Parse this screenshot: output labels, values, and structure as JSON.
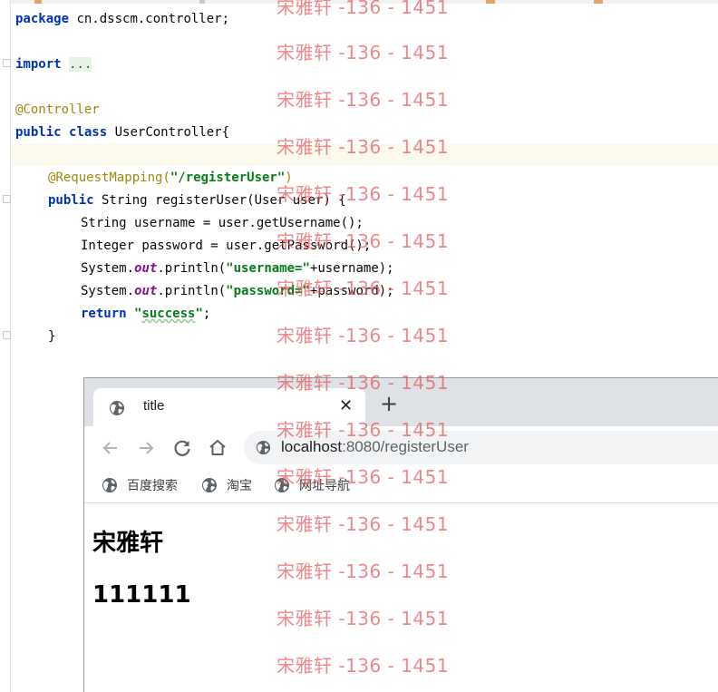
{
  "editor": {
    "line1": {
      "kw": "package",
      "rest": " cn.dsscm.controller;"
    },
    "line2": {
      "kw": "import",
      "folded": "..."
    },
    "line3": {
      "annotation": "@Controller"
    },
    "line4": {
      "kw1": "public",
      "kw2": "class",
      "rest": " UserController{"
    },
    "line5": {
      "annotation": "@RequestMapping(",
      "string": "\"/registerUser\"",
      "close": ")"
    },
    "line6": {
      "kw": "public",
      "rest": " String registerUser(User user) {"
    },
    "line7": {
      "text": "String username = user.getUsername();"
    },
    "line8": {
      "text": "Integer password = user.getPassword();"
    },
    "line9": {
      "prefix": "System.",
      "field": "out",
      "mid": ".println(",
      "string": "\"username=\"",
      "suffix": "+username);"
    },
    "line10": {
      "prefix": "System.",
      "field": "out",
      "mid": ".println(",
      "string": "\"password=\"",
      "suffix": "+password);"
    },
    "line11": {
      "kw": "return",
      "string_open": "\"",
      "string_word": "success",
      "string_close": "\"",
      "suffix": ";"
    },
    "line12": {
      "text": "}"
    }
  },
  "browser": {
    "tab_title": "title",
    "tab_close": "✕",
    "new_tab": "+",
    "url_host": "localhost",
    "url_rest": ":8080/registerUser",
    "bookmarks": [
      {
        "label": "百度搜索",
        "icon": "globe-icon"
      },
      {
        "label": "淘宝",
        "icon": "globe-icon"
      },
      {
        "label": "网址导航",
        "icon": "globe-icon"
      }
    ],
    "page": {
      "username": "宋雅轩",
      "password": "111111"
    }
  },
  "watermark": {
    "text": "宋雅轩 -136 - 1451",
    "color": "#e65a5a"
  },
  "colors": {
    "keyword": "#0033b3",
    "annotation": "#9e880d",
    "string": "#067d17",
    "static_field": "#871094",
    "current_line": "#fcfaed",
    "tabstrip": "#dee1e6"
  }
}
